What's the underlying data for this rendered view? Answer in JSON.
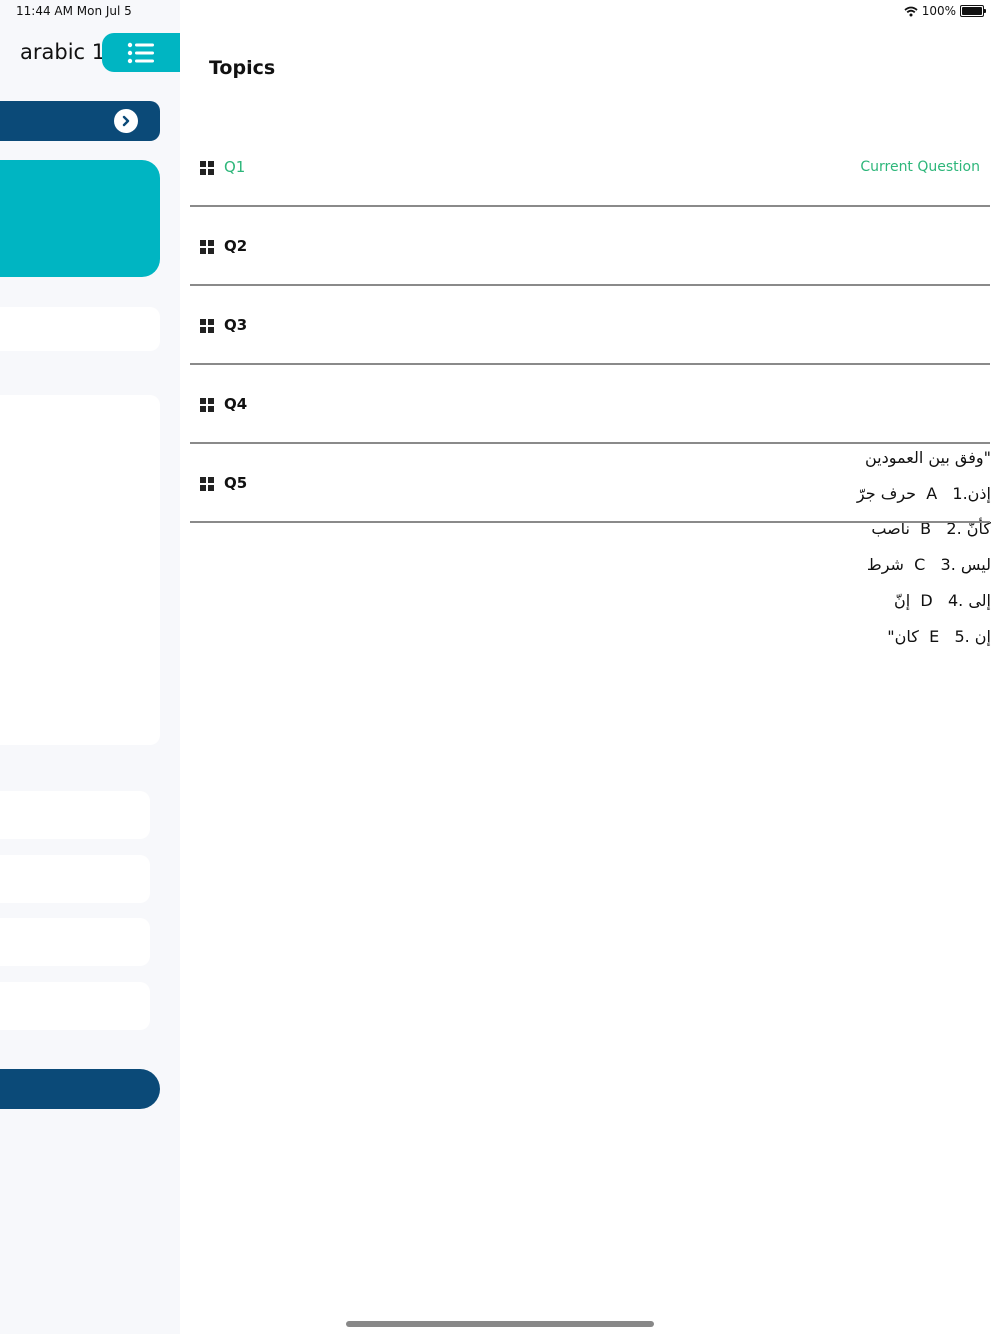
{
  "status_bar": {
    "time": "11:44 AM   Mon Jul 5",
    "battery": "100%",
    "battery_level": 1.0
  },
  "sidebar": {
    "title": "arabic 1",
    "question_text": "وفق بين العمودين\"\nحرف جرّ  A   إذن.1\nناصب  B   كأنّ .2\nشرط  C   ليس .3\nإنّ  D   إلى .4\n\"كان  E   إن .5"
  },
  "topics": {
    "title": "Topics",
    "items": [
      {
        "label": "Q1",
        "status": "Current Question"
      },
      {
        "label": "Q2",
        "status": ""
      },
      {
        "label": "Q3",
        "status": ""
      },
      {
        "label": "Q4",
        "status": ""
      },
      {
        "label": "Q5",
        "status": ""
      }
    ]
  },
  "colors": {
    "accent_teal": "#00b5c2",
    "navy": "#0b4a78",
    "current_green": "#2db67a"
  },
  "icons": {
    "menu": "list-icon",
    "next": "chevron-right-icon",
    "topic": "grid-icon",
    "wifi": "wifi-icon",
    "battery": "battery-icon"
  }
}
